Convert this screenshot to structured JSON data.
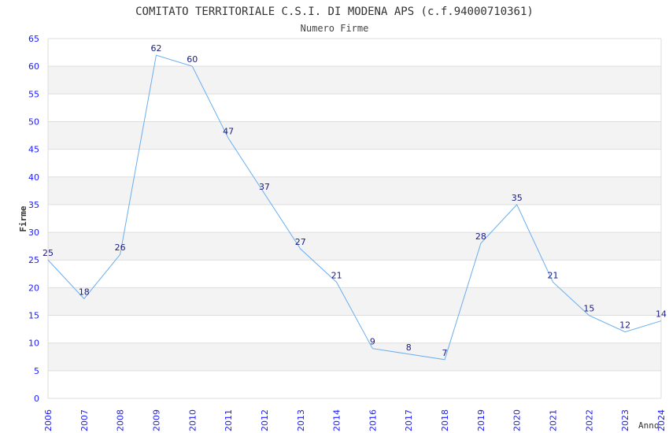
{
  "chart_data": {
    "type": "line",
    "title": "COMITATO TERRITORIALE C.S.I. DI MODENA APS (c.f.94000710361)",
    "subtitle": "Numero Firme",
    "xlabel": "Anno",
    "ylabel": "Firme",
    "categories": [
      "2006",
      "2007",
      "2008",
      "2009",
      "2010",
      "2011",
      "2012",
      "2013",
      "2014",
      "2016",
      "2017",
      "2018",
      "2019",
      "2020",
      "2021",
      "2022",
      "2023",
      "2024"
    ],
    "values": [
      25,
      18,
      26,
      62,
      60,
      47,
      37,
      27,
      21,
      9,
      8,
      7,
      28,
      35,
      21,
      15,
      12,
      14
    ],
    "ylim": [
      0,
      65
    ],
    "yticks": [
      0,
      5,
      10,
      15,
      20,
      25,
      30,
      35,
      40,
      45,
      50,
      55,
      60,
      65
    ],
    "grid": true,
    "colors": {
      "line": "#6aaef0",
      "data_label": "#1a1a80",
      "tick_label": "#1a1aff",
      "band": "#f3f3f3",
      "grid": "#dddddd",
      "title": "#333333"
    }
  }
}
